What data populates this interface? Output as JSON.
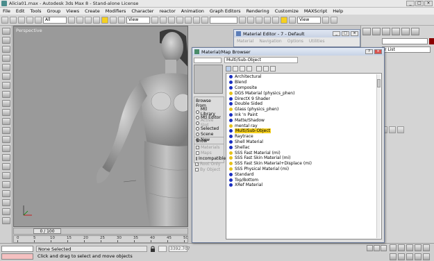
{
  "window": {
    "title": "Alicia01.max - Autodesk 3ds Max 8 - Stand-alone License"
  },
  "menu": [
    "File",
    "Edit",
    "Tools",
    "Group",
    "Views",
    "Create",
    "Modifiers",
    "Character",
    "reactor",
    "Animation",
    "Graph Editors",
    "Rendering",
    "Customize",
    "MAXScript",
    "Help"
  ],
  "toolbar": {
    "selection_filter": "All",
    "ref_coord": "View"
  },
  "viewport": {
    "label": "Perspective"
  },
  "timeline": {
    "frame_label": "0 / 100",
    "ticks": [
      "0",
      "5",
      "10",
      "15",
      "20",
      "25",
      "30",
      "35",
      "40",
      "45",
      "50"
    ]
  },
  "status": {
    "selection": "None Selected",
    "prompt": "Click and drag to select and move objects",
    "x_value": "3392.707"
  },
  "material_editor": {
    "title": "Material Editor - 7 - Default",
    "menu": [
      "Material",
      "Navigation",
      "Options",
      "Utilities"
    ]
  },
  "command_panel": {
    "dropdown": "r List"
  },
  "browser": {
    "title": "Material/Map Browser",
    "selected_name": "Multi/Sub-Object",
    "browse_from_label": "Browse From",
    "browse_from": [
      {
        "label": "Mtl Library",
        "on": false,
        "disabled": false
      },
      {
        "label": "Mtl Editor",
        "on": false,
        "disabled": false
      },
      {
        "label": "Active Slot",
        "on": false,
        "disabled": true
      },
      {
        "label": "Selected",
        "on": false,
        "disabled": false
      },
      {
        "label": "Scene",
        "on": false,
        "disabled": false
      },
      {
        "label": "New",
        "on": true,
        "disabled": false
      }
    ],
    "show_label": "Show",
    "show": [
      {
        "label": "Materials",
        "checked": true,
        "disabled": true
      },
      {
        "label": "Maps",
        "checked": false,
        "disabled": true
      },
      {
        "label": "Incompatible",
        "checked": false,
        "disabled": false
      }
    ],
    "show2": [
      {
        "label": "Root Only",
        "checked": true,
        "disabled": true
      },
      {
        "label": "By Object",
        "checked": false,
        "disabled": true
      }
    ],
    "materials": [
      {
        "label": "Architectural",
        "color": "blue"
      },
      {
        "label": "Blend",
        "color": "blue"
      },
      {
        "label": "Composite",
        "color": "blue"
      },
      {
        "label": "DGS Material (physics_phen)",
        "color": "yellow"
      },
      {
        "label": "DirectX 9 Shader",
        "color": "blue"
      },
      {
        "label": "Double Sided",
        "color": "blue"
      },
      {
        "label": "Glass (physics_phen)",
        "color": "yellow"
      },
      {
        "label": "Ink 'n Paint",
        "color": "blue"
      },
      {
        "label": "Matte/Shadow",
        "color": "blue"
      },
      {
        "label": "mental ray",
        "color": "yellow"
      },
      {
        "label": "Multi/Sub-Object",
        "color": "blue",
        "selected": true
      },
      {
        "label": "Raytrace",
        "color": "blue"
      },
      {
        "label": "Shell Material",
        "color": "blue"
      },
      {
        "label": "Shellac",
        "color": "blue"
      },
      {
        "label": "SSS Fast Material (mi)",
        "color": "yellow"
      },
      {
        "label": "SSS Fast Skin Material (mi)",
        "color": "yellow"
      },
      {
        "label": "SSS Fast Skin Material+Displace (mi)",
        "color": "yellow"
      },
      {
        "label": "SSS Physical Material (mi)",
        "color": "yellow"
      },
      {
        "label": "Standard",
        "color": "blue"
      },
      {
        "label": "Top/Bottom",
        "color": "blue"
      },
      {
        "label": "XRef Material",
        "color": "blue"
      }
    ]
  }
}
